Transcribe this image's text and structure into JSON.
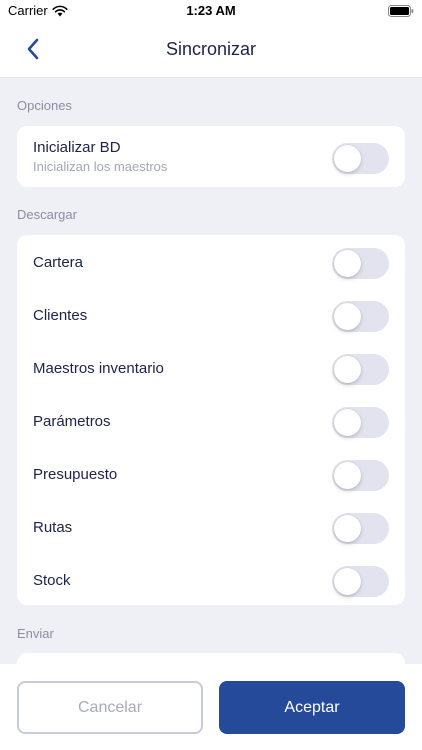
{
  "status_bar": {
    "carrier": "Carrier",
    "time": "1:23 AM"
  },
  "nav": {
    "title": "Sincronizar",
    "back_icon": "chevron-left-icon"
  },
  "sections": {
    "options": {
      "header": "Opciones",
      "items": [
        {
          "label": "Inicializar BD",
          "sublabel": "Inicializan los maestros",
          "on": false
        }
      ]
    },
    "download": {
      "header": "Descargar",
      "items": [
        {
          "label": "Cartera",
          "on": false
        },
        {
          "label": "Clientes",
          "on": false
        },
        {
          "label": "Maestros inventario",
          "on": false
        },
        {
          "label": "Parámetros",
          "on": false
        },
        {
          "label": "Presupuesto",
          "on": false
        },
        {
          "label": "Rutas",
          "on": false
        },
        {
          "label": "Stock",
          "on": false
        }
      ]
    },
    "send": {
      "header": "Enviar"
    }
  },
  "buttons": {
    "cancel": "Cancelar",
    "accept": "Aceptar"
  },
  "colors": {
    "accent": "#254a9a",
    "toggle_off": "#e3e3ef",
    "background": "#eef0f5"
  }
}
